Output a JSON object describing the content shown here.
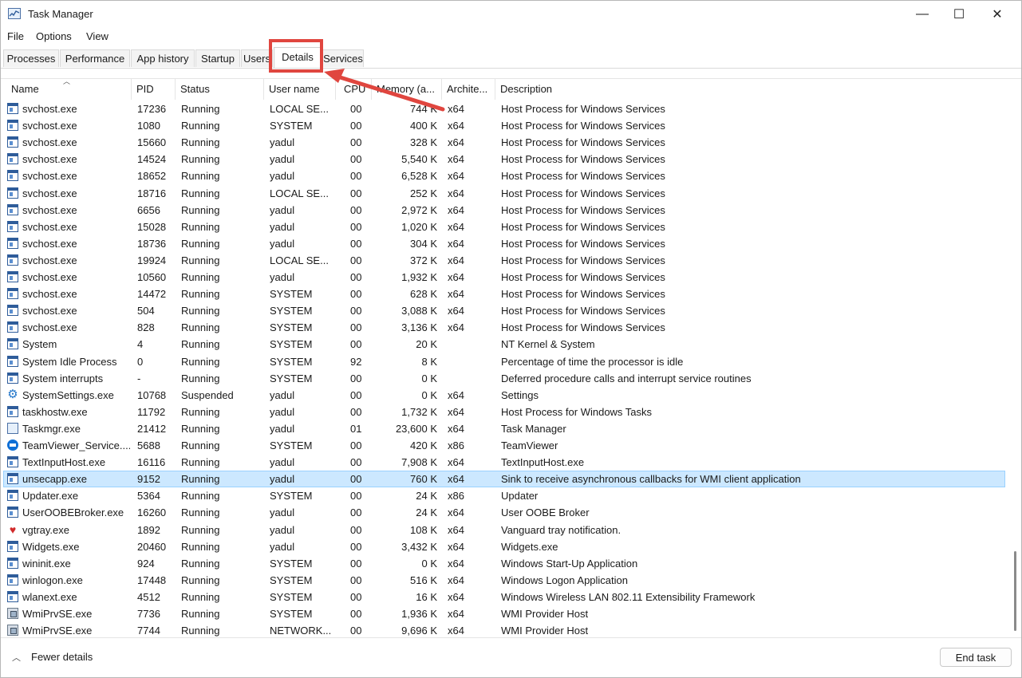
{
  "window": {
    "title": "Task Manager",
    "controls": {
      "minimize": "—",
      "maximize": "☐",
      "close": "✕"
    }
  },
  "menu": [
    "File",
    "Options",
    "View"
  ],
  "tabs": [
    {
      "label": "Processes"
    },
    {
      "label": "Performance"
    },
    {
      "label": "App history"
    },
    {
      "label": "Startup"
    },
    {
      "label": "Users"
    },
    {
      "label": "Details",
      "active": true
    },
    {
      "label": "Services"
    }
  ],
  "columns": [
    "Name",
    "PID",
    "Status",
    "User name",
    "CPU",
    "Memory (a...",
    "Archite...",
    "Description"
  ],
  "rows": [
    {
      "icon": "window",
      "name": "svchost.exe",
      "pid": "17236",
      "status": "Running",
      "user": "LOCAL SE...",
      "cpu": "00",
      "mem": "744 K",
      "arch": "x64",
      "desc": "Host Process for Windows Services"
    },
    {
      "icon": "window",
      "name": "svchost.exe",
      "pid": "1080",
      "status": "Running",
      "user": "SYSTEM",
      "cpu": "00",
      "mem": "400 K",
      "arch": "x64",
      "desc": "Host Process for Windows Services"
    },
    {
      "icon": "window",
      "name": "svchost.exe",
      "pid": "15660",
      "status": "Running",
      "user": "yadul",
      "cpu": "00",
      "mem": "328 K",
      "arch": "x64",
      "desc": "Host Process for Windows Services"
    },
    {
      "icon": "window",
      "name": "svchost.exe",
      "pid": "14524",
      "status": "Running",
      "user": "yadul",
      "cpu": "00",
      "mem": "5,540 K",
      "arch": "x64",
      "desc": "Host Process for Windows Services"
    },
    {
      "icon": "window",
      "name": "svchost.exe",
      "pid": "18652",
      "status": "Running",
      "user": "yadul",
      "cpu": "00",
      "mem": "6,528 K",
      "arch": "x64",
      "desc": "Host Process for Windows Services"
    },
    {
      "icon": "window",
      "name": "svchost.exe",
      "pid": "18716",
      "status": "Running",
      "user": "LOCAL SE...",
      "cpu": "00",
      "mem": "252 K",
      "arch": "x64",
      "desc": "Host Process for Windows Services"
    },
    {
      "icon": "window",
      "name": "svchost.exe",
      "pid": "6656",
      "status": "Running",
      "user": "yadul",
      "cpu": "00",
      "mem": "2,972 K",
      "arch": "x64",
      "desc": "Host Process for Windows Services"
    },
    {
      "icon": "window",
      "name": "svchost.exe",
      "pid": "15028",
      "status": "Running",
      "user": "yadul",
      "cpu": "00",
      "mem": "1,020 K",
      "arch": "x64",
      "desc": "Host Process for Windows Services"
    },
    {
      "icon": "window",
      "name": "svchost.exe",
      "pid": "18736",
      "status": "Running",
      "user": "yadul",
      "cpu": "00",
      "mem": "304 K",
      "arch": "x64",
      "desc": "Host Process for Windows Services"
    },
    {
      "icon": "window",
      "name": "svchost.exe",
      "pid": "19924",
      "status": "Running",
      "user": "LOCAL SE...",
      "cpu": "00",
      "mem": "372 K",
      "arch": "x64",
      "desc": "Host Process for Windows Services"
    },
    {
      "icon": "window",
      "name": "svchost.exe",
      "pid": "10560",
      "status": "Running",
      "user": "yadul",
      "cpu": "00",
      "mem": "1,932 K",
      "arch": "x64",
      "desc": "Host Process for Windows Services"
    },
    {
      "icon": "window",
      "name": "svchost.exe",
      "pid": "14472",
      "status": "Running",
      "user": "SYSTEM",
      "cpu": "00",
      "mem": "628 K",
      "arch": "x64",
      "desc": "Host Process for Windows Services"
    },
    {
      "icon": "window",
      "name": "svchost.exe",
      "pid": "504",
      "status": "Running",
      "user": "SYSTEM",
      "cpu": "00",
      "mem": "3,088 K",
      "arch": "x64",
      "desc": "Host Process for Windows Services"
    },
    {
      "icon": "window",
      "name": "svchost.exe",
      "pid": "828",
      "status": "Running",
      "user": "SYSTEM",
      "cpu": "00",
      "mem": "3,136 K",
      "arch": "x64",
      "desc": "Host Process for Windows Services"
    },
    {
      "icon": "window",
      "name": "System",
      "pid": "4",
      "status": "Running",
      "user": "SYSTEM",
      "cpu": "00",
      "mem": "20 K",
      "arch": "",
      "desc": "NT Kernel & System"
    },
    {
      "icon": "window",
      "name": "System Idle Process",
      "pid": "0",
      "status": "Running",
      "user": "SYSTEM",
      "cpu": "92",
      "mem": "8 K",
      "arch": "",
      "desc": "Percentage of time the processor is idle"
    },
    {
      "icon": "window",
      "name": "System interrupts",
      "pid": "-",
      "status": "Running",
      "user": "SYSTEM",
      "cpu": "00",
      "mem": "0 K",
      "arch": "",
      "desc": "Deferred procedure calls and interrupt service routines"
    },
    {
      "icon": "gear",
      "name": "SystemSettings.exe",
      "pid": "10768",
      "status": "Suspended",
      "user": "yadul",
      "cpu": "00",
      "mem": "0 K",
      "arch": "x64",
      "desc": "Settings"
    },
    {
      "icon": "window",
      "name": "taskhostw.exe",
      "pid": "11792",
      "status": "Running",
      "user": "yadul",
      "cpu": "00",
      "mem": "1,732 K",
      "arch": "x64",
      "desc": "Host Process for Windows Tasks"
    },
    {
      "icon": "chart",
      "name": "Taskmgr.exe",
      "pid": "21412",
      "status": "Running",
      "user": "yadul",
      "cpu": "01",
      "mem": "23,600 K",
      "arch": "x64",
      "desc": "Task Manager"
    },
    {
      "icon": "tv",
      "name": "TeamViewer_Service....",
      "pid": "5688",
      "status": "Running",
      "user": "SYSTEM",
      "cpu": "00",
      "mem": "420 K",
      "arch": "x86",
      "desc": "TeamViewer"
    },
    {
      "icon": "window",
      "name": "TextInputHost.exe",
      "pid": "16116",
      "status": "Running",
      "user": "yadul",
      "cpu": "00",
      "mem": "7,908 K",
      "arch": "x64",
      "desc": "TextInputHost.exe"
    },
    {
      "icon": "window",
      "name": "unsecapp.exe",
      "pid": "9152",
      "status": "Running",
      "user": "yadul",
      "cpu": "00",
      "mem": "760 K",
      "arch": "x64",
      "desc": "Sink to receive asynchronous callbacks for WMI client application",
      "selected": true
    },
    {
      "icon": "window",
      "name": "Updater.exe",
      "pid": "5364",
      "status": "Running",
      "user": "SYSTEM",
      "cpu": "00",
      "mem": "24 K",
      "arch": "x86",
      "desc": "Updater"
    },
    {
      "icon": "window",
      "name": "UserOOBEBroker.exe",
      "pid": "16260",
      "status": "Running",
      "user": "yadul",
      "cpu": "00",
      "mem": "24 K",
      "arch": "x64",
      "desc": "User OOBE Broker"
    },
    {
      "icon": "v",
      "name": "vgtray.exe",
      "pid": "1892",
      "status": "Running",
      "user": "yadul",
      "cpu": "00",
      "mem": "108 K",
      "arch": "x64",
      "desc": "Vanguard tray notification."
    },
    {
      "icon": "window",
      "name": "Widgets.exe",
      "pid": "20460",
      "status": "Running",
      "user": "yadul",
      "cpu": "00",
      "mem": "3,432 K",
      "arch": "x64",
      "desc": "Widgets.exe"
    },
    {
      "icon": "window",
      "name": "wininit.exe",
      "pid": "924",
      "status": "Running",
      "user": "SYSTEM",
      "cpu": "00",
      "mem": "0 K",
      "arch": "x64",
      "desc": "Windows Start-Up Application"
    },
    {
      "icon": "window",
      "name": "winlogon.exe",
      "pid": "17448",
      "status": "Running",
      "user": "SYSTEM",
      "cpu": "00",
      "mem": "516 K",
      "arch": "x64",
      "desc": "Windows Logon Application"
    },
    {
      "icon": "window",
      "name": "wlanext.exe",
      "pid": "4512",
      "status": "Running",
      "user": "SYSTEM",
      "cpu": "00",
      "mem": "16 K",
      "arch": "x64",
      "desc": "Windows Wireless LAN 802.11 Extensibility Framework"
    },
    {
      "icon": "wmi",
      "name": "WmiPrvSE.exe",
      "pid": "7736",
      "status": "Running",
      "user": "SYSTEM",
      "cpu": "00",
      "mem": "1,936 K",
      "arch": "x64",
      "desc": "WMI Provider Host"
    },
    {
      "icon": "wmi",
      "name": "WmiPrvSE.exe",
      "pid": "7744",
      "status": "Running",
      "user": "NETWORK...",
      "cpu": "00",
      "mem": "9,696 K",
      "arch": "x64",
      "desc": "WMI Provider Host"
    }
  ],
  "footer": {
    "fewer_details": "Fewer details",
    "end_task": "End task"
  },
  "colors": {
    "selection": "#cce8ff",
    "highlight": "#e0463f"
  }
}
